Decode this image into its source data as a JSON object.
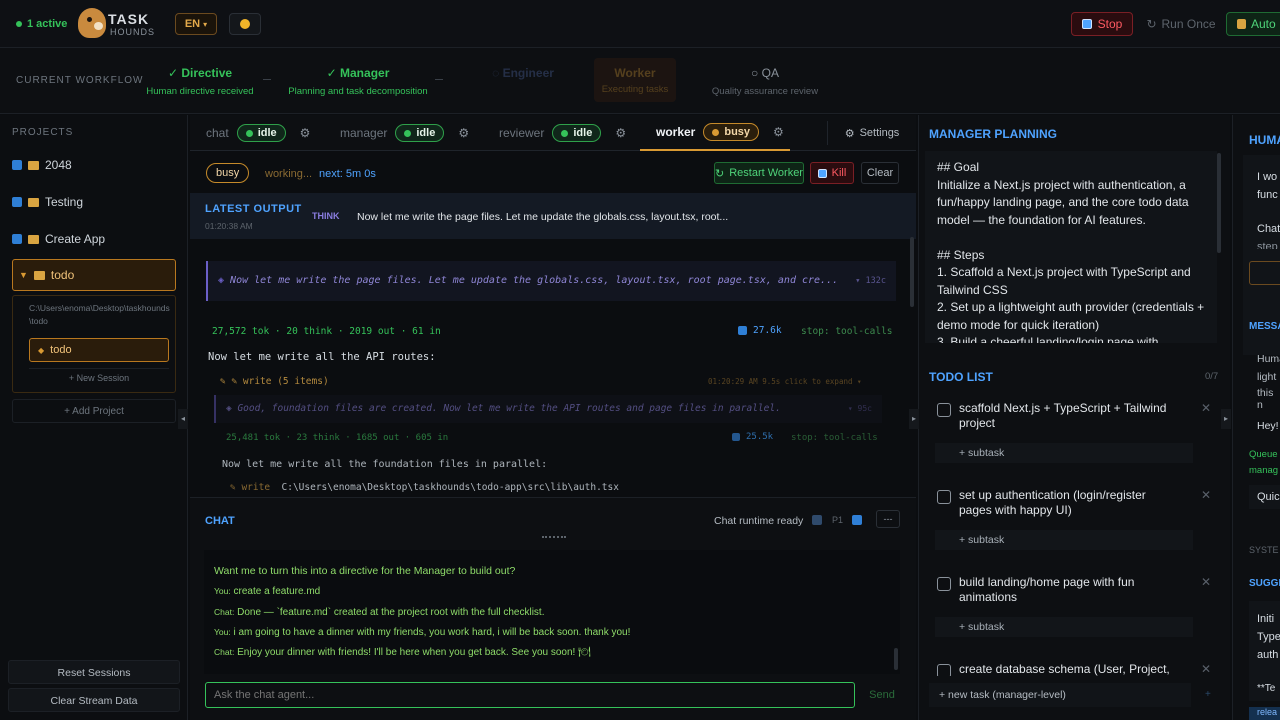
{
  "header": {
    "active_count": "1 active",
    "logo_line1": "TASK",
    "logo_line2": "HOUNDS",
    "lang": "EN",
    "stop_label": "Stop",
    "run_once_label": "Run Once",
    "auto_label": "Auto"
  },
  "workflow": {
    "label": "CURRENT WORKFLOW",
    "steps": [
      {
        "title": "Directive",
        "sub": "Human directive received",
        "state": "done"
      },
      {
        "title": "Manager",
        "sub": "Planning and task decomposition",
        "state": "done"
      },
      {
        "title": "Engineer",
        "sub": "",
        "state": "faded"
      },
      {
        "title": "Worker",
        "sub": "Executing tasks",
        "state": "active"
      },
      {
        "title": "QA",
        "sub": "Quality assurance review",
        "state": "pending"
      }
    ]
  },
  "sidebar": {
    "projects_label": "PROJECTS",
    "projects": [
      "2048",
      "Testing",
      "Create App",
      "todo"
    ],
    "selected_path": "C:\\Users\\enoma\\Desktop\\taskhounds\\todo",
    "session": "todo",
    "new_session": "+ New Session",
    "add_project": "+ Add Project",
    "reset_sessions": "Reset Sessions",
    "clear_stream": "Clear Stream Data"
  },
  "tabs": [
    {
      "name": "chat",
      "state": "idle"
    },
    {
      "name": "manager",
      "state": "idle"
    },
    {
      "name": "reviewer",
      "state": "idle"
    },
    {
      "name": "worker",
      "state": "busy"
    }
  ],
  "settings_label": "Settings",
  "worker": {
    "status": "busy",
    "working": "working...",
    "next": "next: 5m 0s",
    "restart": "Restart Worker",
    "kill": "Kill",
    "clear": "Clear",
    "latest_output_label": "LATEST OUTPUT",
    "latest_time": "01:20:38 AM",
    "think_tag": "THINK",
    "latest_text": "Now let me write the page files. Let me update the globals.css, layout.tsx, root...",
    "think1": "Now let me write the page files. Let me update the globals.css, layout.tsx, root page.tsx, and cre...",
    "think1_count": "132c",
    "stats1": "27,572 tok · 20 think · 2019 out · 61 in",
    "stats1_tokens": "27.6k",
    "stats1_stop": "stop: tool-calls",
    "msg1": "Now let me write all the API routes:",
    "write_label": "write (5 items)",
    "write_time": "01:20:29 AM",
    "write_dur": "9.5s",
    "write_hint": "click to expand",
    "think2": "Good, foundation files are created. Now let me write the API routes and page files in parallel.",
    "think2_count": "95c",
    "stats2": "25,481 tok · 23 think · 1685 out · 605 in",
    "stats2_tokens": "25.5k",
    "stats2_stop": "stop: tool-calls",
    "msg2": "Now let me write all the foundation files in parallel:",
    "write2_label": "write",
    "write2_path": "C:\\Users\\enoma\\Desktop\\taskhounds\\todo-app\\src\\lib\\auth.tsx"
  },
  "chat": {
    "label": "CHAT",
    "runtime": "Chat runtime ready",
    "p1": "P1",
    "menu": "---",
    "lines": [
      {
        "who": "",
        "text": "Want me to turn this into a directive for the Manager to build out?"
      },
      {
        "who": "You:",
        "text": "create a feature.md"
      },
      {
        "who": "Chat:",
        "text": "Done — `feature.md` created at the project root with the full checklist."
      },
      {
        "who": "You:",
        "text": "i am going to have a dinner with my friends, you work hard, i will be back soon. thank you!"
      },
      {
        "who": "Chat:",
        "text": "Enjoy your dinner with friends! I'll be here when you get back. See you soon! 🍽"
      }
    ],
    "placeholder": "Ask the chat agent...",
    "send": "Send"
  },
  "manager": {
    "title": "MANAGER PLANNING",
    "plan": "## Goal\nInitialize a Next.js project with authentication, a fun/happy landing page, and the core todo data model — the foundation for AI features.\n\n## Steps\n1. Scaffold a Next.js project with TypeScript and Tailwind CSS\n2. Set up a lightweight auth provider (credentials + demo mode for quick iteration)\n3. Build a cheerful landing/login page with",
    "todo_label": "TODO LIST",
    "todo_count": "0/7",
    "todos": [
      "scaffold Next.js + TypeScript + Tailwind project",
      "set up authentication (login/register pages with happy UI)",
      "build landing/home page with fun animations",
      "create database schema (User, Project,"
    ],
    "subtask": "+ subtask",
    "new_task": "+ new task (manager-level)"
  },
  "human": {
    "title": "HUMAN",
    "l1": "I wo",
    "l2": "func",
    "l3": "Chat",
    "l4": "step",
    "mess": "MESSA",
    "m1": "Huma",
    "m2": "light",
    "m3": "this n",
    "hey": "Hey!",
    "queued": "Queue",
    "queued2": "manag",
    "quick": "Quic",
    "system": "SYSTE",
    "sugg": "SUGGE",
    "s1": "Initi",
    "s2": "Type",
    "s3": "auth",
    "s4": "**Te",
    "rel": "relea"
  },
  "colors": {
    "accent_blue": "#4fa3ff",
    "green": "#35c25a",
    "orange": "#d99a33",
    "red": "#e0434b"
  }
}
